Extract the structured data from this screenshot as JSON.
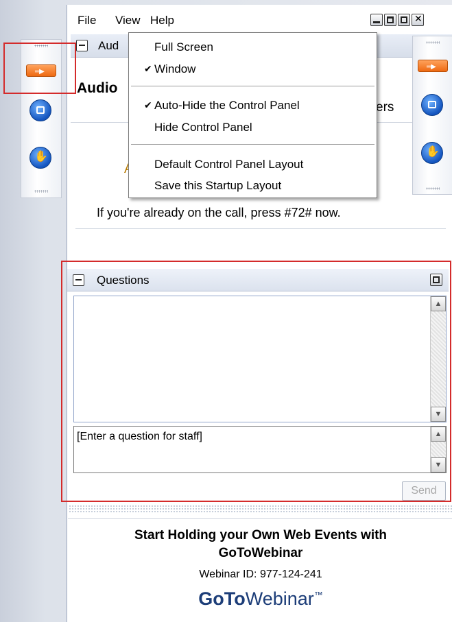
{
  "menubar": {
    "file": "File",
    "view": "View",
    "help": "Help"
  },
  "audio": {
    "header_partial": "Aud",
    "title_partial": "Audio",
    "title_trailing": "ers",
    "partial_text": "A",
    "call_text": "If you're already on the call, press #72# now."
  },
  "view_menu": {
    "items": [
      {
        "label": "Full Screen",
        "checked": false
      },
      {
        "label": "Window",
        "checked": true
      },
      {
        "label": "Auto-Hide the Control Panel",
        "checked": true
      },
      {
        "label": "Hide Control Panel",
        "checked": false
      },
      {
        "label": "Default Control Panel Layout",
        "checked": false
      },
      {
        "label": "Save this Startup Layout",
        "checked": false
      }
    ],
    "check_glyph": "✔"
  },
  "questions": {
    "title": "Questions",
    "input_placeholder": "[Enter a question for staff]",
    "send_label": "Send"
  },
  "footer": {
    "promo_line1": "Start Holding your Own Web Events with",
    "promo_line2": "GoToWebinar",
    "webinar_id": "Webinar ID: 977-124-241",
    "brand_bold": "GoTo",
    "brand_regular": "Webinar",
    "brand_tm": "™"
  },
  "colors": {
    "highlight": "#d42b2b",
    "accent_orange": "#ee6a13",
    "accent_blue": "#1455bf",
    "brand_blue": "#1c3d78"
  }
}
